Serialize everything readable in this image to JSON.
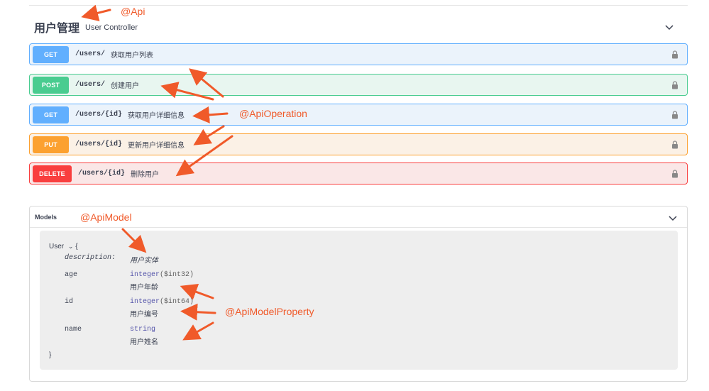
{
  "tag": {
    "name": "用户管理",
    "description": "User Controller"
  },
  "operations": [
    {
      "method": "GET",
      "path": "/users/",
      "summary": "获取用户列表"
    },
    {
      "method": "POST",
      "path": "/users/",
      "summary": "创建用户"
    },
    {
      "method": "GET",
      "path": "/users/{id}",
      "summary": "获取用户详细信息"
    },
    {
      "method": "PUT",
      "path": "/users/{id}",
      "summary": "更新用户详细信息"
    },
    {
      "method": "DELETE",
      "path": "/users/{id}",
      "summary": "删除用户"
    }
  ],
  "models": {
    "title": "Models",
    "model": {
      "name": "User",
      "open_brace": "{",
      "close_brace": "}",
      "description_label": "description:",
      "description": "用户实体",
      "properties": [
        {
          "name": "age",
          "type": "integer",
          "format": "($int32)",
          "description": "用户年龄"
        },
        {
          "name": "id",
          "type": "integer",
          "format": "($int64)",
          "description": "用户编号"
        },
        {
          "name": "name",
          "type": "string",
          "format": "",
          "description": "用户姓名"
        }
      ]
    }
  },
  "annotations": {
    "api": "@Api",
    "api_operation": "@ApiOperation",
    "api_model": "@ApiModel",
    "api_model_property": "@ApiModelProperty"
  },
  "colors": {
    "get": "#61affe",
    "post": "#49cc90",
    "put": "#fca130",
    "delete": "#f93e3e",
    "annotation": "#f05a2a"
  },
  "icons": [
    "chevron-down-icon",
    "lock-icon",
    "chevron-down-icon"
  ]
}
